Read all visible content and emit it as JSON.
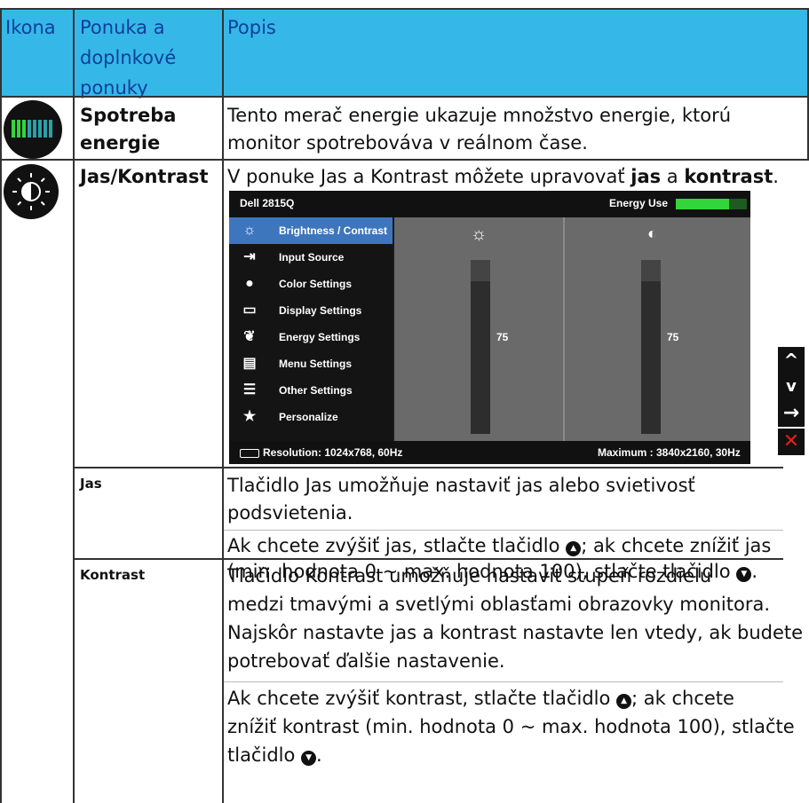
{
  "header": {
    "col1": "Ikona",
    "col2_line1": "Ponuka a",
    "col2_line2": "doplnkové",
    "col2_line3": "ponuky",
    "col3": "Popis"
  },
  "rows": {
    "energy": {
      "name_line1": "Spotreba",
      "name_line2": "energie",
      "desc_line1": "Tento merač energie ukazuje množstvo energie, ktorú",
      "desc_line2": "monitor spotrebováva v reálnom čase."
    },
    "brightness_contrast": {
      "name": "Jas/Kontrast",
      "desc_pre": "V ponuke Jas a Kontrast môžete upravovať ",
      "desc_bold1": "jas",
      "desc_mid": " a ",
      "desc_bold2": "kontrast",
      "desc_post": "."
    },
    "brightness": {
      "name": "Jas",
      "desc_line1": "Tlačidlo Jas umožňuje nastaviť jas alebo svietivosť",
      "desc_line2": "podsvietenia.",
      "desc_line3": "Ak chcete zvýšiť jas, stlačte tlačidlo",
      "desc_line3b": "; ak chcete znížiť jas",
      "desc_line4": "(min. hodnota 0 ~ max. hodnota 100), stlačte tlačidlo",
      "desc_line4b": "."
    },
    "contrast": {
      "name": "Kontrast",
      "desc_line1": "Tlačidlo Kontrast umožňuje nastaviť stupeň rozdielu",
      "desc_line2": "medzi tmavými a svetlými oblasťami obrazovky monitora.",
      "desc_line3": "Najskôr nastavte jas a kontrast nastavte len vtedy, ak budete",
      "desc_line4": "potrebovať ďalšie nastavenie.",
      "desc_line5": "Ak chcete zvýšiť kontrast, stlačte tlačidlo",
      "desc_line5b": "; ak chcete",
      "desc_line6": "znížiť kontrast (min. hodnota 0 ~ max. hodnota 100), stlačte",
      "desc_line7": "tlačidlo",
      "desc_line7b": "."
    }
  },
  "osd": {
    "model": "Dell 2815Q",
    "energy_label": "Energy Use",
    "menu": [
      {
        "icon": "☼",
        "label": "Brightness / Contrast"
      },
      {
        "icon": "⇥",
        "label": "Input Source"
      },
      {
        "icon": "●",
        "label": "Color Settings"
      },
      {
        "icon": "▭",
        "label": "Display Settings"
      },
      {
        "icon": "❦",
        "label": "Energy Settings"
      },
      {
        "icon": "▤",
        "label": "Menu Settings"
      },
      {
        "icon": "☰",
        "label": "Other Settings"
      },
      {
        "icon": "★",
        "label": "Personalize"
      }
    ],
    "brightness_value": "75",
    "contrast_value": "75",
    "brightness_level": 75,
    "contrast_level": 75,
    "resolution": "Resolution: 1024x768,  60Hz",
    "maximum": "Maximum : 3840x2160,  30Hz"
  },
  "nav_buttons": {
    "up": "^",
    "down": "v",
    "enter": "→",
    "exit": "✕"
  },
  "colors": {
    "header_bg": "#35b8e8",
    "header_text": "#0e3f9a",
    "osd_selected": "#3e76bd",
    "energy_green": "#33d63a",
    "exit_red": "#e0201b"
  }
}
